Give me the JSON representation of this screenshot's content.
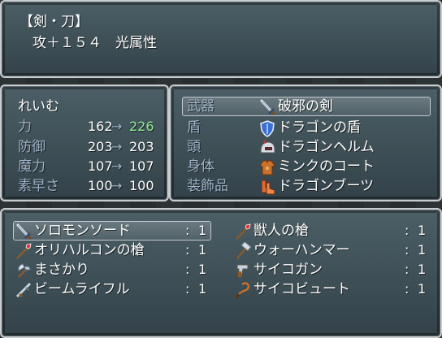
{
  "help": {
    "line1": "【剣・刀】",
    "line2": "攻＋１５４　光属性"
  },
  "status": {
    "actor_name": "れいむ",
    "stats": [
      {
        "label": "力",
        "from": "162",
        "arrow": "→",
        "to": "226",
        "improved": true
      },
      {
        "label": "防御",
        "from": "203",
        "arrow": "→",
        "to": "203",
        "improved": false
      },
      {
        "label": "魔力",
        "from": "107",
        "arrow": "→",
        "to": "107",
        "improved": false
      },
      {
        "label": "素早さ",
        "from": "100",
        "arrow": "→",
        "to": "100",
        "improved": false
      }
    ]
  },
  "equip": {
    "slots": [
      {
        "slot": "武器",
        "item": "破邪の剣",
        "icon": "sword-icon"
      },
      {
        "slot": "盾",
        "item": "ドラゴンの盾",
        "icon": "shield-icon"
      },
      {
        "slot": "頭",
        "item": "ドラゴンヘルム",
        "icon": "helmet-icon"
      },
      {
        "slot": "身体",
        "item": "ミンクのコート",
        "icon": "armor-icon"
      },
      {
        "slot": "装飾品",
        "item": "ドラゴンブーツ",
        "icon": "boots-icon"
      }
    ],
    "selected_index": 0
  },
  "inventory": {
    "items": [
      {
        "name": "ソロモンソード",
        "sep": ":",
        "count": "1",
        "icon": "sword-icon"
      },
      {
        "name": "獣人の槍",
        "sep": ":",
        "count": "1",
        "icon": "spear-icon"
      },
      {
        "name": "オリハルコンの槍",
        "sep": ":",
        "count": "1",
        "icon": "spear-icon"
      },
      {
        "name": "ウォーハンマー",
        "sep": ":",
        "count": "1",
        "icon": "hammer-icon"
      },
      {
        "name": "まさかり",
        "sep": ":",
        "count": "1",
        "icon": "axe-icon"
      },
      {
        "name": "サイコガン",
        "sep": ":",
        "count": "1",
        "icon": "gun-icon"
      },
      {
        "name": "ビームライフル",
        "sep": ":",
        "count": "1",
        "icon": "rifle-icon"
      },
      {
        "name": "サイコビュート",
        "sep": ":",
        "count": "1",
        "icon": "whip-icon"
      }
    ],
    "selected_index": 0
  },
  "colors": {
    "system_text": "#9fb3c8",
    "power_up_text": "#90e890"
  }
}
